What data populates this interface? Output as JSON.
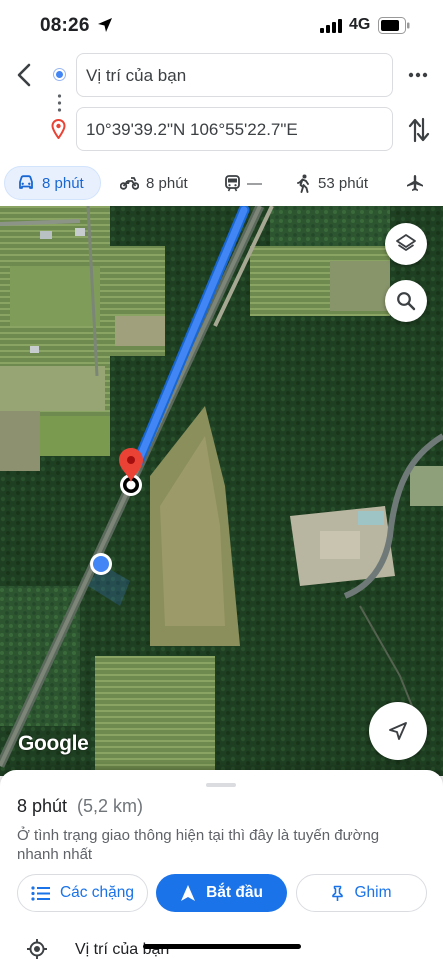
{
  "status_bar": {
    "time": "08:26",
    "network": "4G",
    "icons": [
      "location-arrow-icon",
      "signal-icon",
      "battery-icon"
    ]
  },
  "route": {
    "start_value": "Vị trí của bạn",
    "destination_value": "10°39'39.2\"N 106°55'22.7\"E",
    "icons": [
      "back-icon",
      "origin-dot-icon",
      "destination-pin-icon",
      "more-icon",
      "swap-icon"
    ]
  },
  "modes": [
    {
      "id": "car",
      "icon": "car-icon",
      "label": "8 phút",
      "selected": true
    },
    {
      "id": "motorbike",
      "icon": "motorbike-icon",
      "label": "8 phút"
    },
    {
      "id": "transit",
      "icon": "train-icon",
      "label": "—"
    },
    {
      "id": "walk",
      "icon": "walk-icon",
      "label": "53 phút"
    },
    {
      "id": "flight",
      "icon": "airplane-icon",
      "label": ""
    }
  ],
  "map": {
    "attribution": "Google",
    "controls": [
      "layers-icon",
      "search-icon",
      "navigate-arrow-icon"
    ],
    "route_color": "#4285f4"
  },
  "summary": {
    "duration": "8 phút",
    "distance": "(5,2 km)",
    "note": "Ở tình trạng giao thông hiện tại thì đây là tuyến đường nhanh nhất"
  },
  "actions": {
    "steps_label": "Các chặng",
    "start_label": "Bắt đầu",
    "pin_label": "Ghim"
  },
  "steps": [
    {
      "icon": "my-location-icon",
      "label": "Vị trí của bạn"
    }
  ],
  "colors": {
    "accent": "#1a73e8",
    "selected_mode_bg": "#e8f0fe",
    "destination_pin": "#ea4335"
  }
}
